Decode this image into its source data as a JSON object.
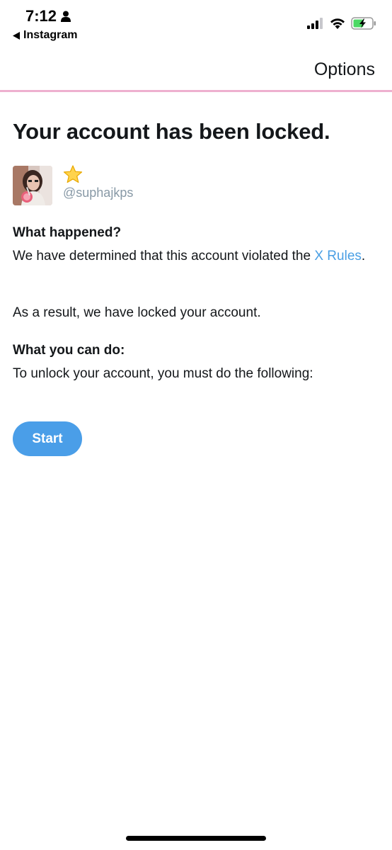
{
  "status_bar": {
    "time": "7:12",
    "back_app": "Instagram",
    "icons": [
      "person-icon",
      "signal-icon",
      "wifi-icon",
      "battery-charging-icon"
    ],
    "battery_color": "#4cd964"
  },
  "nav": {
    "options_label": "Options",
    "divider_color": "#eeb0cf"
  },
  "main": {
    "title": "Your account has been locked.",
    "user": {
      "handle": "@suphajkps",
      "badge_emoji": "⭐"
    },
    "what_happened_heading": "What happened?",
    "what_happened_text": "We have determined that this account violated the ",
    "rules_link": "X Rules",
    "what_happened_end": ".",
    "result_text": "As a result, we have locked your account.",
    "what_you_can_do_heading": "What you can do:",
    "what_you_can_do_text": "To unlock your account, you must do the following:",
    "start_label": "Start"
  },
  "colors": {
    "accent": "#4a9ee8",
    "link": "#4a9fe4",
    "muted": "#8899a6"
  }
}
